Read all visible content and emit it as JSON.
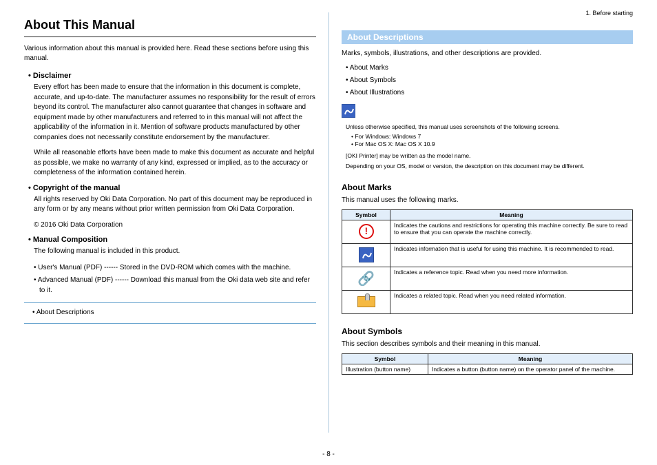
{
  "header": {
    "breadcrumb": "1. Before starting"
  },
  "left": {
    "title": "About This Manual",
    "intro": "Various information about this manual is provided here. Read these sections before using this manual.",
    "disclaimer": {
      "heading": "Disclaimer",
      "p1": "Every effort has been made to ensure that the information in this document is complete, accurate, and up-to-date. The manufacturer assumes no responsibility for the result of errors beyond its control. The manufacturer also cannot guarantee that changes in software and equipment made by other manufacturers and referred to in this manual will not affect the applicability of the information in it. Mention of software products manufactured by other companies does not necessarily constitute endorsement by the manufacturer.",
      "p2": "While all reasonable efforts have been made to make this document as accurate and helpful as possible, we make no warranty of any kind, expressed or implied, as to the accuracy or completeness of the information contained herein."
    },
    "copyright": {
      "heading": "Copyright of the manual",
      "p1": "All rights reserved by Oki Data Corporation. No part of this document may be reproduced in any form or by any means without prior written permission from Oki Data Corporation.",
      "p2": "© 2016 Oki Data Corporation"
    },
    "composition": {
      "heading": "Manual Composition",
      "intro": "The following manual is included in this product.",
      "items": [
        "User's Manual (PDF) ------ Stored in the DVD-ROM which comes with the machine.",
        "Advanced Manual (PDF) ------ Download this manual from the Oki data web site and refer to it."
      ]
    },
    "toc": {
      "item1": "About Descriptions"
    }
  },
  "right": {
    "banner": "About Descriptions",
    "intro": "Marks, symbols, illustrations, and other descriptions are provided.",
    "toc": [
      "About Marks",
      "About Symbols",
      "About Illustrations"
    ],
    "note": {
      "line1": "Unless otherwise specified, this manual uses screenshots of the following screens.",
      "b1": "For Windows: Windows 7",
      "b2": "For Mac OS X: Mac OS X 10.9",
      "line2": "[OKI Printer] may be written as the model name.",
      "line3": "Depending on your OS, model or version, the description on this document may be different."
    },
    "marks": {
      "heading": "About Marks",
      "intro": "This manual uses the following marks.",
      "th_symbol": "Symbol",
      "th_meaning": "Meaning",
      "rows": [
        {
          "meaning": "Indicates the cautions and restrictions for operating this machine correctly. Be sure to read to ensure that you can operate the machine correctly."
        },
        {
          "meaning": "Indicates information that is useful for using this machine. It is recommended to read."
        },
        {
          "meaning": "Indicates a reference topic. Read when you need more information."
        },
        {
          "meaning": "Indicates a related topic. Read when you need related information."
        }
      ]
    },
    "symbols": {
      "heading": "About Symbols",
      "intro": "This section describes symbols and their meaning in this manual.",
      "th_symbol": "Symbol",
      "th_meaning": "Meaning",
      "row_symbol": "Illustration (button name)",
      "row_meaning": "Indicates a button (button name) on the operator panel of the machine."
    }
  },
  "page": "- 8 -"
}
